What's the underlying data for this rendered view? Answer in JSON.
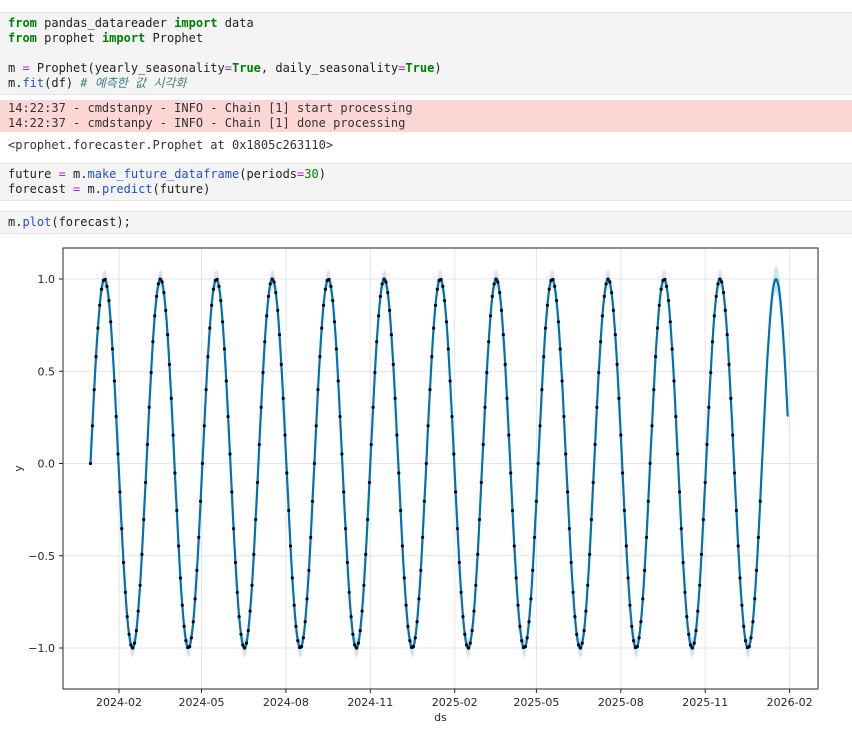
{
  "notebook": {
    "cells": [
      {
        "kind": "code",
        "label": "imports-and-fit-cell",
        "lines": [
          [
            {
              "t": "from",
              "c": "kw"
            },
            {
              "t": " pandas_datareader ",
              "c": "nm"
            },
            {
              "t": "import",
              "c": "kw"
            },
            {
              "t": " data",
              "c": "nm"
            }
          ],
          [
            {
              "t": "from",
              "c": "kw"
            },
            {
              "t": " prophet ",
              "c": "nm"
            },
            {
              "t": "import",
              "c": "kw"
            },
            {
              "t": " Prophet",
              "c": "nm"
            }
          ],
          [],
          [
            {
              "t": "m ",
              "c": "nm"
            },
            {
              "t": "=",
              "c": "op"
            },
            {
              "t": " Prophet(yearly_seasonality",
              "c": "nm"
            },
            {
              "t": "=",
              "c": "op"
            },
            {
              "t": "True",
              "c": "kw"
            },
            {
              "t": ", daily_seasonality",
              "c": "nm"
            },
            {
              "t": "=",
              "c": "op"
            },
            {
              "t": "True",
              "c": "kw"
            },
            {
              "t": ")",
              "c": "nm"
            }
          ],
          [
            {
              "t": "m.",
              "c": "nm"
            },
            {
              "t": "fit",
              "c": "fn"
            },
            {
              "t": "(df) ",
              "c": "nm"
            },
            {
              "t": "# 예측한 값 시각화",
              "c": "cm"
            }
          ]
        ]
      },
      {
        "kind": "stderr",
        "label": "cmdstanpy-log-output",
        "lines": [
          "14:22:37 - cmdstanpy - INFO - Chain [1] start processing",
          "14:22:37 - cmdstanpy - INFO - Chain [1] done processing"
        ]
      },
      {
        "kind": "plain",
        "label": "repr-output",
        "text": "<prophet.forecaster.Prophet at 0x1805c263110>"
      },
      {
        "kind": "code",
        "label": "make-future-cell",
        "lines": [
          [
            {
              "t": "future ",
              "c": "nm"
            },
            {
              "t": "=",
              "c": "op"
            },
            {
              "t": " m.",
              "c": "nm"
            },
            {
              "t": "make_future_dataframe",
              "c": "fn"
            },
            {
              "t": "(periods",
              "c": "nm"
            },
            {
              "t": "=",
              "c": "op"
            },
            {
              "t": "30",
              "c": "num"
            },
            {
              "t": ")",
              "c": "nm"
            }
          ],
          [
            {
              "t": "forecast ",
              "c": "nm"
            },
            {
              "t": "=",
              "c": "op"
            },
            {
              "t": " m.",
              "c": "nm"
            },
            {
              "t": "predict",
              "c": "fn"
            },
            {
              "t": "(future)",
              "c": "nm"
            }
          ]
        ]
      },
      {
        "kind": "code",
        "label": "plot-cell",
        "lines": [
          [
            {
              "t": "m.",
              "c": "nm"
            },
            {
              "t": "plot",
              "c": "fn"
            },
            {
              "t": "(forecast);",
              "c": "nm"
            }
          ]
        ]
      }
    ]
  },
  "chart_data": {
    "type": "line",
    "subtype": "prophet-forecast (fitted line + uncertainty band + observed scatter points)",
    "title": "",
    "xlabel": "ds",
    "ylabel": "y",
    "x_tick_labels": [
      "2024-02",
      "2024-05",
      "2024-08",
      "2024-11",
      "2025-02",
      "2025-05",
      "2025-08",
      "2025-11",
      "2026-02"
    ],
    "x_tick_days": [
      31,
      121,
      213,
      305,
      397,
      486,
      578,
      670,
      762
    ],
    "y_tick_values": [
      1.0,
      0.5,
      0.0,
      -0.5,
      -1.0
    ],
    "y_tick_labels": [
      "1.0",
      "0.5",
      "0.0",
      "−0.5",
      "−1.0"
    ],
    "xlim_days": [
      -30,
      793
    ],
    "ylim": [
      -1.222,
      1.168
    ],
    "grid": true,
    "legend": "none",
    "start_date": "2024-01-01",
    "period_days": 61,
    "amplitude": 1.0,
    "formula": "y = sin(2*pi*t/61), t = days since 2024-01-01",
    "history": {
      "style": "scatter",
      "color": "#000000",
      "start_day": 0,
      "end_day": 730,
      "step_days": 2,
      "first_point": {
        "day": 0,
        "y": 0.0
      }
    },
    "forecast_line": {
      "style": "line",
      "color": "#0072B2",
      "start_day": 0,
      "end_day": 760,
      "end_value_approx": 0.2
    },
    "uncertainty_band": {
      "style": "band",
      "color": "#0072B2",
      "opacity": 0.18,
      "half_width": 0.05,
      "half_width_forecast_end": 0.09
    },
    "colors": {
      "line": "#0072B2",
      "points": "#000000",
      "grid": "#e6e6e6",
      "spine": "#262626"
    }
  }
}
